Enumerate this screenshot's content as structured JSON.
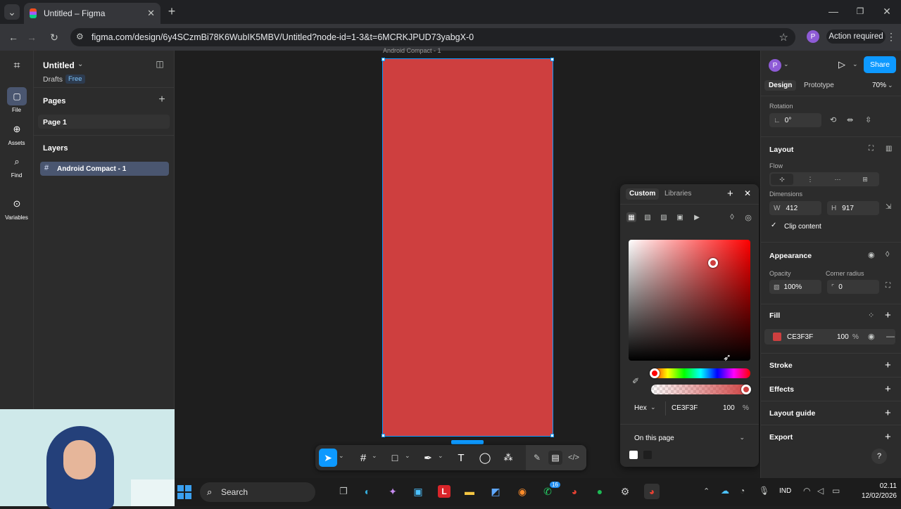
{
  "browser": {
    "tab_title": "Untitled – Figma",
    "url": "figma.com/design/6y4SCzmBi78K6WubIK5MBV/Untitled?node-id=1-3&t=6MCRKJPUD73yabgX-0",
    "profile_initial": "P",
    "action_required": "Action required"
  },
  "rail": [
    {
      "label": "File"
    },
    {
      "label": "Assets"
    },
    {
      "label": "Find"
    },
    {
      "label": "Variables"
    }
  ],
  "left": {
    "file_name": "Untitled",
    "drafts": "Drafts",
    "plan": "Free",
    "pages_heading": "Pages",
    "page1": "Page 1",
    "layers_heading": "Layers",
    "layer1": "Android Compact - 1"
  },
  "canvas": {
    "frame_label": "Android Compact - 1",
    "frame_color": "#CE3F3F"
  },
  "right": {
    "avatar": "P",
    "share": "Share",
    "tab_design": "Design",
    "tab_prototype": "Prototype",
    "zoom": "70%",
    "rotation_label": "Rotation",
    "rotation_value": "0°",
    "layout_heading": "Layout",
    "flow_label": "Flow",
    "dimensions_label": "Dimensions",
    "w_prefix": "W",
    "w_value": "412",
    "h_prefix": "H",
    "h_value": "917",
    "clip_content": "Clip content",
    "appearance_heading": "Appearance",
    "opacity_label": "Opacity",
    "opacity_value": "100%",
    "corner_label": "Corner radius",
    "corner_value": "0",
    "fill_heading": "Fill",
    "fill_hex": "CE3F3F",
    "fill_opacity": "100",
    "fill_pct": "%",
    "stroke_heading": "Stroke",
    "effects_heading": "Effects",
    "layout_guide_heading": "Layout guide",
    "export_heading": "Export",
    "help": "?"
  },
  "picker": {
    "tab_custom": "Custom",
    "tab_libraries": "Libraries",
    "format": "Hex",
    "hex": "CE3F3F",
    "alpha": "100",
    "alpha_pct": "%",
    "scope": "On this page"
  },
  "taskbar": {
    "search": "Search",
    "lang": "IND",
    "time": "02.11",
    "date": "12/02/2026",
    "whatsapp_badge": "16"
  }
}
